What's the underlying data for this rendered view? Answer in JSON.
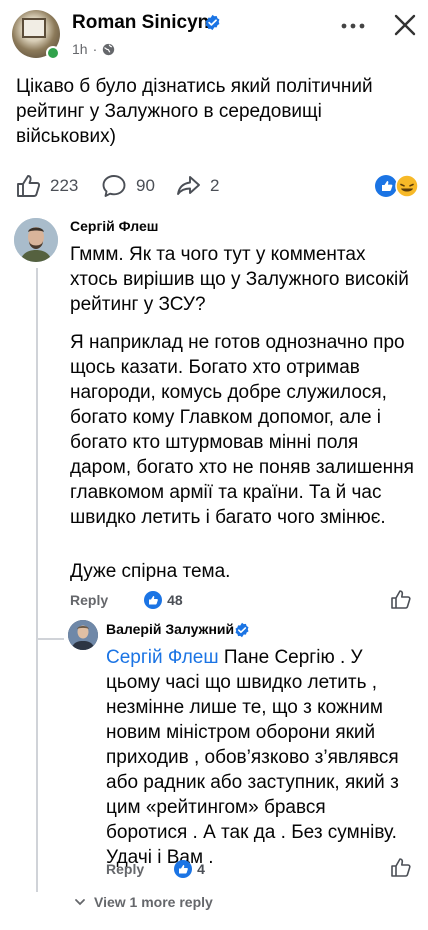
{
  "post": {
    "author": "Roman Sinicyn",
    "time": "1h",
    "text": "Цікаво б було дізнатись який політичний рейтинг у Залужного в середовищі військових)",
    "likes": "223",
    "comments": "90",
    "shares": "2"
  },
  "comment1": {
    "author": "Сергій Флеш",
    "paragraph1": "Гммм. Як та чого тут у комментах хтось вирішив що у Залужного високій рейтинг у ЗСУ?",
    "paragraph2": "Я наприклад не готов однозначно про щось казати. Богато хто отримав нагороди, комусь добре служилося, богато кому Главком допомог, але і богато кто штурмовав мінні поля даром, богато хто не поняв залишення главкомом армії та країни. Та й час швидко летить і багато чого змінює.",
    "paragraph3": "Дуже спірна тема.",
    "reply_label": "Reply",
    "likes": "48"
  },
  "comment2": {
    "author": "Валерій Залужний",
    "mention": "Сергій Флеш",
    "text": " Пане Сергію . У цьому часі що швидко летить , незмінне лише те, що з кожним новим міністром оборони який приходив , обов’язково з’являвся або радник або заступник, який з цим «рейтингом» брався боротися . А так да . Без сумніву. Удачі і Вам .",
    "reply_label": "Reply",
    "likes": "4"
  },
  "view_more": "View 1 more reply",
  "colors": {
    "accent": "#1b74e4",
    "muted": "#65676b",
    "online": "#31a24c"
  }
}
